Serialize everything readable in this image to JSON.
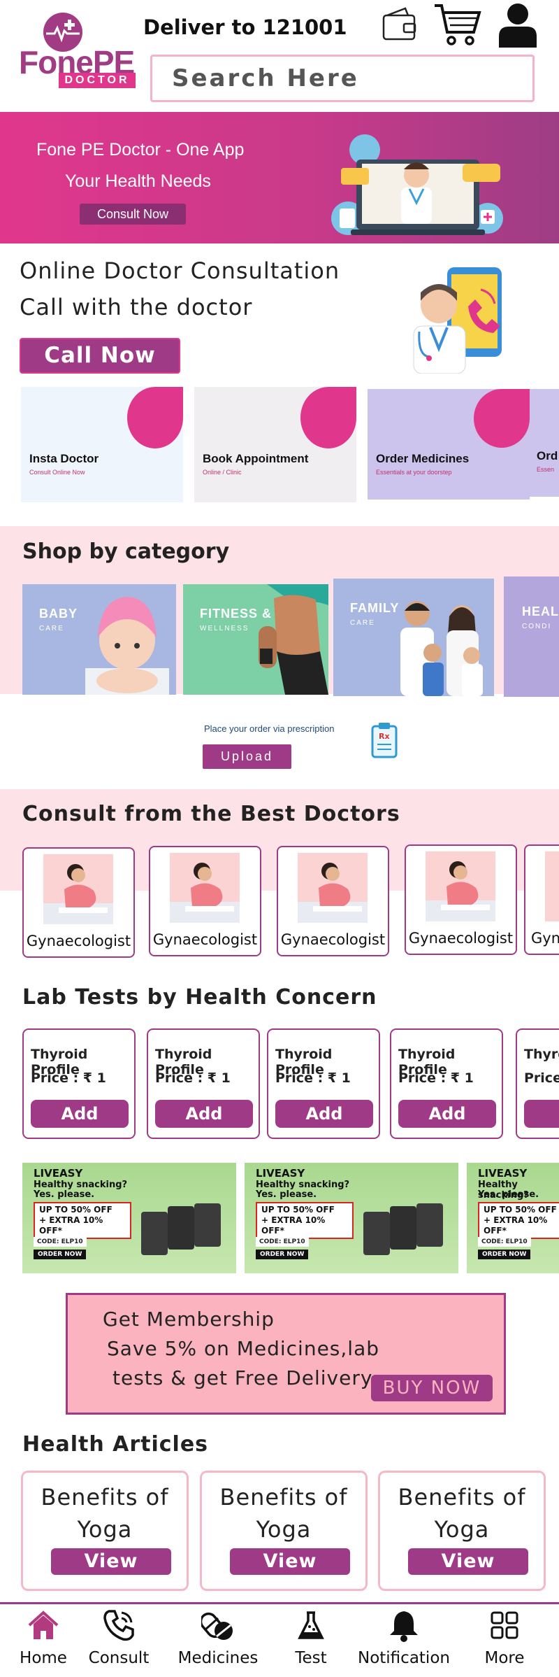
{
  "header": {
    "logo": {
      "main": "FonePE",
      "sub": "DOCTOR"
    },
    "deliver_label": "Deliver to 121001",
    "search_placeholder": "Search Here",
    "icons": [
      "wallet-icon",
      "cart-icon",
      "user-icon"
    ]
  },
  "hero": {
    "line1": "Fone PE Doctor - One App",
    "line2": "Your Health Needs",
    "button": "Consult Now"
  },
  "online_consult": {
    "title": "Online Doctor Consultation",
    "subtitle": "Call with the doctor",
    "button": "Call Now"
  },
  "services": [
    {
      "title": "Insta Doctor",
      "sub": "Consult Online Now",
      "bg": "#eef5fc"
    },
    {
      "title": "Book Appointment",
      "sub": "Online / Clinic",
      "bg": "#f1eef2"
    },
    {
      "title": "Order Medicines",
      "sub": "Essentials at your doorstep",
      "bg": "#cdc4ee"
    },
    {
      "title": "Ord",
      "sub": "Essen",
      "bg": "#cdc4ee"
    }
  ],
  "shop": {
    "title": "Shop by category",
    "categories": [
      {
        "label": "BABY",
        "sub": "CARE",
        "bg": "#a8b7e2"
      },
      {
        "label": "FITNESS &",
        "sub": "WELLNESS",
        "bg": "#7dcfa6"
      },
      {
        "label": "FAMILY",
        "sub": "CARE",
        "bg": "#a8b7e2"
      },
      {
        "label": "HEAL",
        "sub": "CONDI",
        "bg": "#b3a6dc"
      }
    ]
  },
  "prescription": {
    "text": "Place your order via prescription",
    "button": "Upload"
  },
  "doctors": {
    "title": "Consult from the Best Doctors",
    "items": [
      "Gynaecologist",
      "Gynaecologist",
      "Gynaecologist",
      "Gynaecologist",
      "Gyn"
    ]
  },
  "lab": {
    "title": "Lab Tests by Health Concern",
    "items": [
      {
        "name": "Thyroid Profile",
        "price": "Price : ₹ 1",
        "button": "Add"
      },
      {
        "name": "Thyroid Profile",
        "price": "Price : ₹ 1",
        "button": "Add"
      },
      {
        "name": "Thyroid Profile",
        "price": "Price : ₹ 1",
        "button": "Add"
      },
      {
        "name": "Thyroid Profile",
        "price": "Price : ₹ 1",
        "button": "Add"
      },
      {
        "name": "Thyro",
        "price": "Price",
        "button": "A"
      }
    ]
  },
  "promo": {
    "brand": "LIVEASY",
    "line1": "Healthy snacking?",
    "line2": "Yes. please.",
    "offer1": "UP TO 50% OFF",
    "offer2": "+ EXTRA 10% OFF*",
    "code": "CODE: ELP10",
    "order": "ORDER NOW"
  },
  "membership": {
    "line1": "Get Membership",
    "line2": "Save 5% on Medicines,lab",
    "line3": "tests & get Free Delivery",
    "button": "BUY NOW"
  },
  "articles": {
    "title": "Health Articles",
    "items": [
      {
        "line1": "Benefits of",
        "line2": "Yoga",
        "button": "View"
      },
      {
        "line1": "Benefits of",
        "line2": "Yoga",
        "button": "View"
      },
      {
        "line1": "Benefits of",
        "line2": "Yoga",
        "button": "View"
      }
    ]
  },
  "nav": [
    {
      "label": "Home",
      "icon": "home-icon",
      "active": true
    },
    {
      "label": "Consult",
      "icon": "phone-icon"
    },
    {
      "label": "Medicines",
      "icon": "pills-icon"
    },
    {
      "label": "Test",
      "icon": "flask-icon"
    },
    {
      "label": "Notification",
      "icon": "bell-icon"
    },
    {
      "label": "More",
      "icon": "grid-icon"
    }
  ],
  "colors": {
    "brand": "#9e3a86",
    "accent": "#e0378c",
    "pink_bg": "#fde3e8"
  }
}
